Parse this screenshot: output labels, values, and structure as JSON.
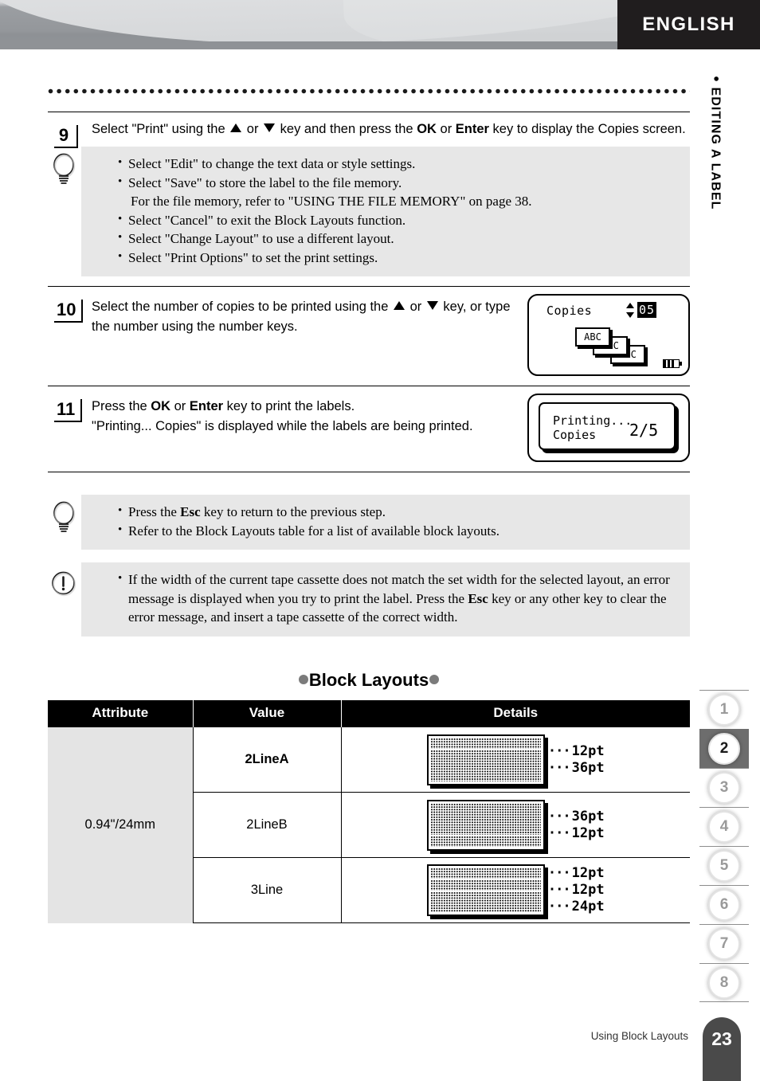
{
  "header": {
    "language_badge": "ENGLISH",
    "chapter_label": "EDITING A LABEL",
    "chapter_bullet": "●"
  },
  "steps": [
    {
      "number": "9",
      "text_parts": {
        "a": "Select \"Print\" using the ",
        "b": " or ",
        "c": " key and then press the ",
        "ok": "OK",
        "d": " or ",
        "enter": "Enter",
        "e": " key to display the Copies screen."
      }
    },
    {
      "number": "10",
      "text_parts": {
        "a": "Select the number of copies to be printed using the ",
        "b": " or ",
        "c": " key, or type the number using the number keys."
      }
    },
    {
      "number": "11",
      "text_parts": {
        "a": "Press the ",
        "ok": "OK",
        "b": " or ",
        "enter": "Enter",
        "c": " key to print the labels.",
        "d": "\"Printing... Copies\" is displayed while the labels are being printed."
      }
    }
  ],
  "tip_step9": {
    "icon": "lightbulb-icon",
    "items": [
      {
        "text": "Select \"Edit\" to change the text data or style settings."
      },
      {
        "text": "Select \"Save\" to store the label to the file memory.",
        "cont": "For the file memory, refer to \"USING THE FILE MEMORY\" on page 38."
      },
      {
        "text": "Select \"Cancel\" to exit the Block Layouts function."
      },
      {
        "text": "Select \"Change Layout\" to use a different layout."
      },
      {
        "text": "Select \"Print Options\" to set the print settings."
      }
    ]
  },
  "tip_bottom": {
    "icon": "lightbulb-icon",
    "items": [
      {
        "pre": "Press the ",
        "bold": "Esc",
        "post": " key to return to the previous step."
      },
      {
        "pre": "Refer to the Block Layouts table for a list of available block layouts.",
        "bold": "",
        "post": ""
      }
    ]
  },
  "warning": {
    "icon": "exclamation-circle-icon",
    "pre": "If the width of the current tape cassette does not match the set width for the selected layout, an error message is displayed when you try to print the label. Press the ",
    "bold": "Esc",
    "post": " key or any other key to clear the error message, and insert a tape cassette of the correct width."
  },
  "lcd_copies": {
    "title": "Copies",
    "value": "05",
    "label_1": "ABC",
    "label_2": "ABC",
    "label_3": "ABC"
  },
  "lcd_printing": {
    "line1": "Printing...",
    "line2": "Copies",
    "fraction": "2/5"
  },
  "section": {
    "heading": "Block Layouts"
  },
  "table": {
    "headers": [
      "Attribute",
      "Value",
      "Details"
    ],
    "attribute": "0.94\"/24mm",
    "rows": [
      {
        "value": "2LineA",
        "bold": true,
        "sizes": [
          "12pt",
          "36pt"
        ],
        "weights": [
          1,
          3
        ]
      },
      {
        "value": "2LineB",
        "bold": false,
        "sizes": [
          "36pt",
          "12pt"
        ],
        "weights": [
          3,
          1
        ]
      },
      {
        "value": "3Line",
        "bold": false,
        "sizes": [
          "12pt",
          "12pt",
          "24pt"
        ],
        "weights": [
          1,
          1,
          2
        ]
      }
    ]
  },
  "tab_rail": {
    "items": [
      "1",
      "2",
      "3",
      "4",
      "5",
      "6",
      "7",
      "8"
    ],
    "active": "2"
  },
  "footer": {
    "caption": "Using Block Layouts",
    "page_number": "23"
  },
  "colors": {
    "banner_black": "#201d1e",
    "table_header": "#000000",
    "attr_cell": "#e4e4e4",
    "note_bg": "#e7e7e7",
    "tab_active": "#6d6d6d",
    "page_tab": "#4a4a4a"
  }
}
